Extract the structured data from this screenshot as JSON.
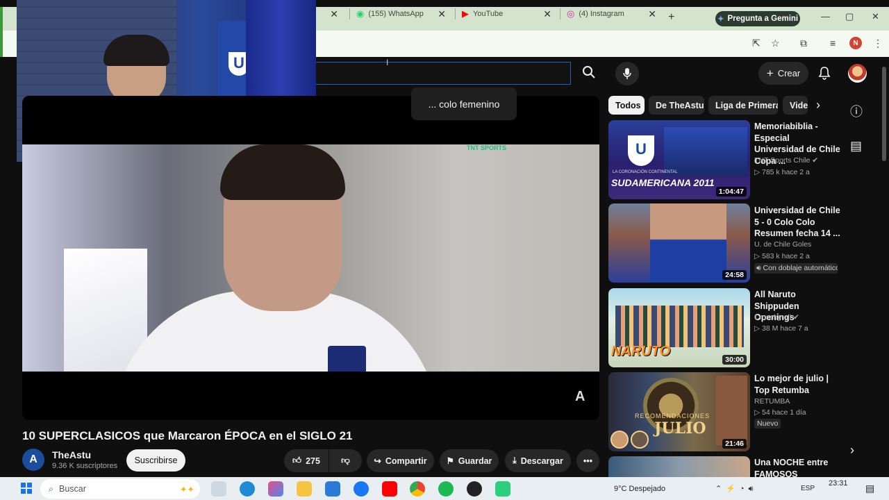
{
  "browser": {
    "tabs": [
      {
        "label": "(155) WhatsApp",
        "icon": "whatsapp-icon"
      },
      {
        "label": "YouTube",
        "icon": "youtube-icon"
      },
      {
        "label": "(4) Instagram",
        "icon": "instagram-icon"
      }
    ],
    "new_tab": "+",
    "gemini_label": "Pregunta a Gemini",
    "profile_initial": "N"
  },
  "youtube": {
    "search_query": "",
    "create_label": "Crear",
    "tooltip": "... colo femenino",
    "video": {
      "title": "10 SUPERCLASICOS que Marcaron ÉPOCA en el SIGLO 21",
      "channel": "TheAstu",
      "channel_initial": "A",
      "subscribers": "9.36 K suscriptores",
      "subscribe_label": "Suscribirse",
      "likes": "275",
      "share_label": "Compartir",
      "save_label": "Guardar",
      "download_label": "Descargar",
      "tnt_logo": "TNT SPORTS",
      "watermark": "A"
    },
    "chips": [
      "Todos",
      "De TheAstu",
      "Liga de Primera",
      "Vide"
    ],
    "recommendations": [
      {
        "title": "Memoriabiblia - Especial Universidad de Chile Copa ...",
        "channel": "TNT Sports Chile",
        "views": "785 k",
        "age": "hace 2 a",
        "duration": "1:04:47",
        "overlay": "SUDAMERICANA 2011",
        "subtitle": "LA CORONACIÓN CONTINENTAL"
      },
      {
        "title": "Universidad de Chile 5 - 0 Colo Colo Resumen fecha 14 ...",
        "channel": "U. de Chile Goles",
        "views": "583 k",
        "age": "hace 2 a",
        "duration": "24:58",
        "badge": "Con doblaje automático"
      },
      {
        "title": "All Naruto Shippuden Openings",
        "channel": "Crunchyroll",
        "views": "38 M",
        "age": "hace 7 a",
        "duration": "30:00",
        "overlay": "NARUTO"
      },
      {
        "title": "Lo mejor de julio | Top Retumba",
        "channel": "RETUMBA",
        "views": "54",
        "age": "hace 1 día",
        "duration": "21:46",
        "badge": "Nuevo",
        "overlay": "JULIO",
        "subtitle": "RECOMENDACIONES"
      },
      {
        "title": "Una NOCHE entre FAMOSOS",
        "channel": "",
        "views": "",
        "age": "",
        "duration": ""
      }
    ]
  },
  "taskbar": {
    "search_placeholder": "Buscar",
    "weather": "9°C Despejado",
    "language": "ESP",
    "time": "23:31"
  },
  "colors": {
    "accent_blue": "#1c62b9",
    "yt_dark": "#0f0f0f",
    "chrome_green": "#d3e3cd"
  }
}
